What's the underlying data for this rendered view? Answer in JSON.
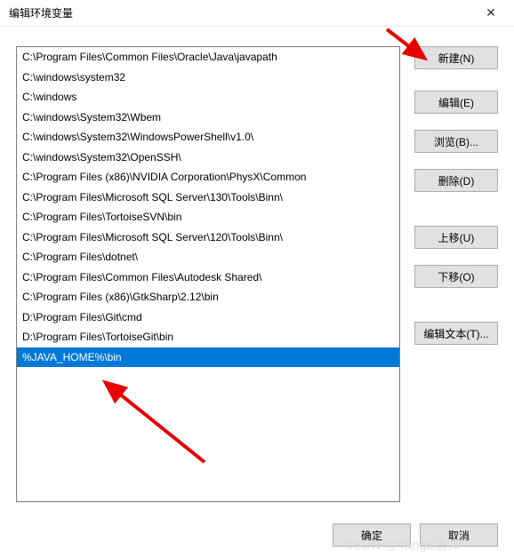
{
  "window": {
    "title": "编辑环境变量",
    "close_glyph": "✕"
  },
  "list": {
    "items": [
      "C:\\Program Files\\Common Files\\Oracle\\Java\\javapath",
      "C:\\windows\\system32",
      "C:\\windows",
      "C:\\windows\\System32\\Wbem",
      "C:\\windows\\System32\\WindowsPowerShell\\v1.0\\",
      "C:\\windows\\System32\\OpenSSH\\",
      "C:\\Program Files (x86)\\NVIDIA Corporation\\PhysX\\Common",
      "C:\\Program Files\\Microsoft SQL Server\\130\\Tools\\Binn\\",
      "C:\\Program Files\\TortoiseSVN\\bin",
      "C:\\Program Files\\Microsoft SQL Server\\120\\Tools\\Binn\\",
      "C:\\Program Files\\dotnet\\",
      "C:\\Program Files\\Common Files\\Autodesk Shared\\",
      "C:\\Program Files (x86)\\GtkSharp\\2.12\\bin",
      "D:\\Program Files\\Git\\cmd",
      "D:\\Program Files\\TortoiseGit\\bin",
      "%JAVA_HOME%\\bin"
    ],
    "selected_index": 15
  },
  "buttons": {
    "new": "新建(N)",
    "edit": "编辑(E)",
    "browse": "浏览(B)...",
    "delete": "删除(D)",
    "move_up": "上移(U)",
    "move_down": "下移(O)",
    "edit_text": "编辑文本(T)...",
    "ok": "确定",
    "cancel": "取消"
  },
  "watermark": "CSDN @TangZ唐泽"
}
